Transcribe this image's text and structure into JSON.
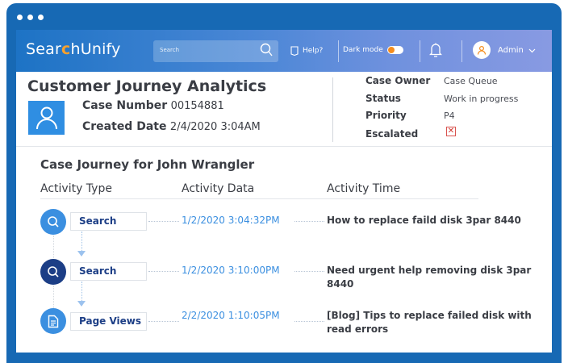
{
  "header": {
    "logo_pre": "Sear",
    "logo_mid": "c",
    "logo_post": "hUnify",
    "search_placeholder": "Search",
    "help_label": "Help?",
    "dark_mode_label": "Dark mode",
    "admin_label": "Admin"
  },
  "case": {
    "title": "Customer Journey Analytics",
    "case_number_label": "Case Number",
    "case_number": "00154881",
    "created_label": "Created Date",
    "created_value": "2/4/2020 3:04AM"
  },
  "meta": {
    "owner_label": "Case Owner",
    "owner_value": "Case Queue",
    "status_label": "Status",
    "status_value": "Work in progress",
    "priority_label": "Priority",
    "priority_value": "P4",
    "escalated_label": "Escalated",
    "escalated_mark": "✕"
  },
  "journey": {
    "title": "Case Journey for John Wrangler",
    "columns": [
      "Activity Type",
      "Activity Data",
      "Activity Time"
    ],
    "rows": [
      {
        "type": "Search",
        "time": "1/2/2020  3:04:32PM",
        "data": "How to replace faild disk 3par 8440"
      },
      {
        "type": "Search",
        "time": "1/2/2020  3:10:00PM",
        "data": "Need urgent help removing disk 3par 8440"
      },
      {
        "type": "Page Views",
        "time": "2/2/2020  1:10:05PM",
        "data": "[Blog] Tips to replace failed disk with read errors"
      }
    ]
  },
  "colors": {
    "frame": "#1769b4",
    "accent_orange": "#f9a12c",
    "icon_blue": "#2f8ee2",
    "dark_navy": "#1c3e86",
    "time_blue": "#3b8fe0"
  }
}
